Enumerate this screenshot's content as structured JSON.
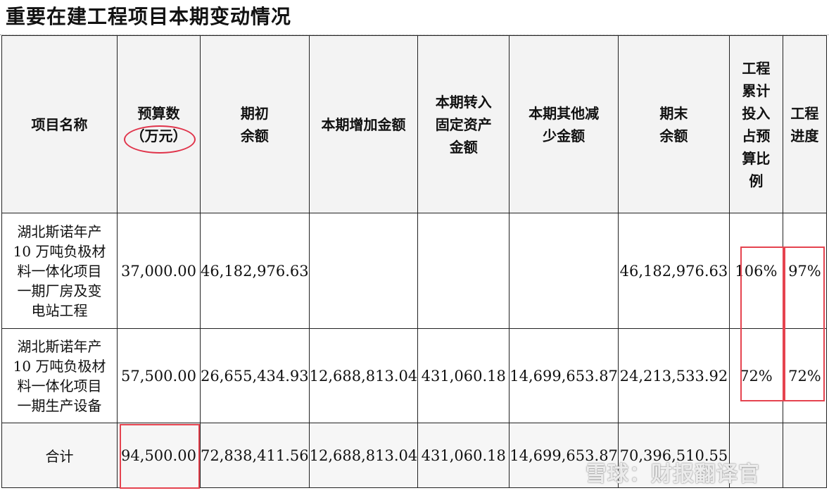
{
  "title": "重要在建工程项目本期变动情况",
  "headers": {
    "name": [
      "项目名称"
    ],
    "budget": [
      "预算数",
      "（万元）"
    ],
    "opening": [
      "期初",
      "余额"
    ],
    "increase": [
      "本期增加金额"
    ],
    "transfer": [
      "本期转入",
      "固定资产",
      "金额"
    ],
    "decrease": [
      "本期其他减",
      "少金额"
    ],
    "closing": [
      "期末",
      "余额"
    ],
    "ratio": [
      "工程",
      "累计",
      "投入",
      "占预",
      "算比",
      "例"
    ],
    "progress": [
      "工程",
      "进度"
    ]
  },
  "rows": [
    {
      "name": [
        "湖北斯诺年产",
        "10 万吨负极材",
        "料一体化项目",
        "一期厂房及变",
        "电站工程"
      ],
      "budget": "37,000.00",
      "opening": "46,182,976.63",
      "increase": "",
      "transfer": "",
      "decrease": "",
      "closing": "46,182,976.63",
      "ratio": "106%",
      "progress": "97%"
    },
    {
      "name": [
        "湖北斯诺年产",
        "10 万吨负极材",
        "料一体化项目",
        "一期生产设备"
      ],
      "budget": "57,500.00",
      "opening": "26,655,434.93",
      "increase": "12,688,813.04",
      "transfer": "431,060.18",
      "decrease": "14,699,653.87",
      "closing": "24,213,533.92",
      "ratio": "72%",
      "progress": "72%"
    }
  ],
  "total": {
    "label": "合计",
    "budget": "94,500.00",
    "opening": "72,838,411.56",
    "increase": "12,688,813.04",
    "transfer": "431,060.18",
    "decrease": "14,699,653.87",
    "closing": "70,396,510.55"
  },
  "watermark": "雪球：财报翻译官",
  "annotation_color": "#e5434f"
}
